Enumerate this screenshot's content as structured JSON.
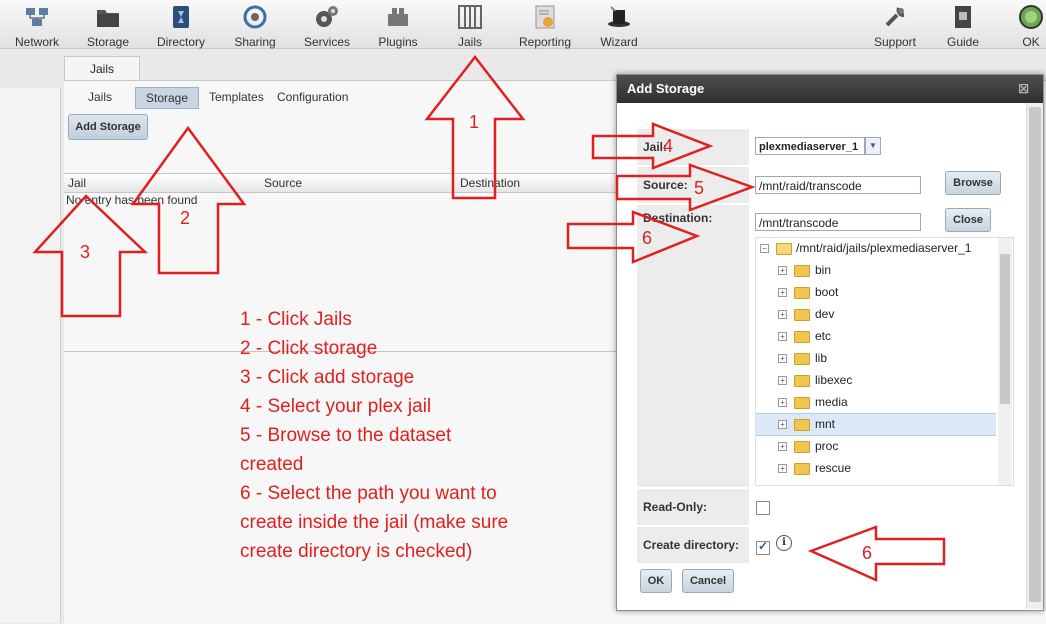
{
  "toolbar": {
    "items": [
      {
        "label": "Network",
        "icon": "network-icon"
      },
      {
        "label": "Storage",
        "icon": "storage-icon"
      },
      {
        "label": "Directory",
        "icon": "directory-icon"
      },
      {
        "label": "Sharing",
        "icon": "sharing-icon"
      },
      {
        "label": "Services",
        "icon": "services-icon"
      },
      {
        "label": "Plugins",
        "icon": "plugins-icon"
      },
      {
        "label": "Jails",
        "icon": "jails-icon"
      },
      {
        "label": "Reporting",
        "icon": "reporting-icon"
      },
      {
        "label": "Wizard",
        "icon": "wizard-icon"
      },
      {
        "label": "Support",
        "icon": "support-icon"
      },
      {
        "label": "Guide",
        "icon": "guide-icon"
      },
      {
        "label": "OK",
        "icon": "ok-icon"
      }
    ]
  },
  "main": {
    "tab": "Jails",
    "subtabs": [
      "Jails",
      "Storage",
      "Templates",
      "Configuration"
    ],
    "active_subtab": "Storage",
    "add_storage_label": "Add Storage",
    "columns": [
      "Jail",
      "Source",
      "Destination"
    ],
    "empty_text": "No entry has been found"
  },
  "annotations": {
    "steps": [
      "1 - Click Jails",
      "2 - Click storage",
      "3 - Click add storage",
      "4 - Select your plex jail",
      "5 - Browse to the dataset created",
      "6 - Select the path you want to create inside the jail (make sure create directory is checked)"
    ],
    "numbers": [
      "1",
      "2",
      "3",
      "4",
      "5",
      "6",
      "6"
    ],
    "color": "#e02020"
  },
  "dialog": {
    "title": "Add Storage",
    "close_glyph": "☒",
    "jail_label": "Jail:",
    "jail_value": "plexmediaserver_1",
    "source_label": "Source:",
    "source_value": "/mnt/raid/transcode",
    "browse_label": "Browse",
    "destination_label": "Destination:",
    "destination_value": "/mnt/transcode",
    "close_label": "Close",
    "tree_root": "/mnt/raid/jails/plexmediaserver_1",
    "tree_items": [
      "bin",
      "boot",
      "dev",
      "etc",
      "lib",
      "libexec",
      "media",
      "mnt",
      "proc",
      "rescue"
    ],
    "selected_item": "mnt",
    "readonly_label": "Read-Only:",
    "readonly_checked": false,
    "create_dir_label": "Create directory:",
    "create_dir_checked": true,
    "ok_label": "OK",
    "cancel_label": "Cancel"
  }
}
